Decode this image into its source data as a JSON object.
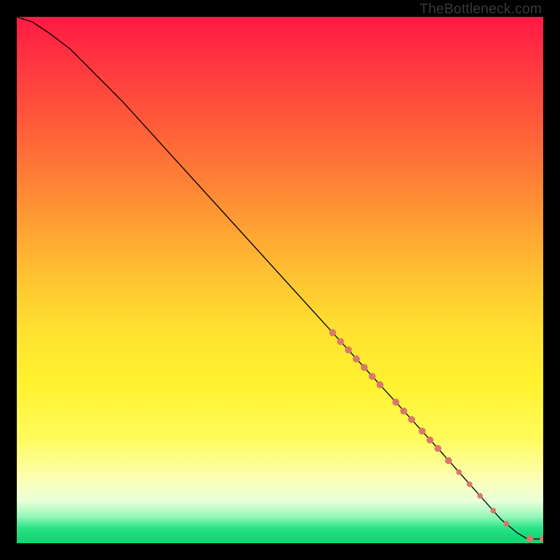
{
  "watermark": "TheBottleneck.com",
  "chart_data": {
    "type": "line",
    "title": "",
    "xlabel": "",
    "ylabel": "",
    "xlim": [
      0,
      100
    ],
    "ylim": [
      0,
      100
    ],
    "line": {
      "x": [
        0,
        3,
        6,
        10,
        15,
        20,
        30,
        40,
        50,
        60,
        70,
        80,
        88,
        92,
        95,
        97,
        100
      ],
      "y": [
        100,
        99,
        97,
        94,
        89,
        84,
        73,
        62,
        51,
        40,
        29,
        18,
        9,
        4.5,
        2,
        0.8,
        0.8
      ]
    },
    "markers": {
      "color": "#d9786b",
      "points": [
        {
          "x": 60.0,
          "y": 40.0,
          "r": 5
        },
        {
          "x": 61.5,
          "y": 38.3,
          "r": 5
        },
        {
          "x": 63.0,
          "y": 36.7,
          "r": 5
        },
        {
          "x": 64.5,
          "y": 35.0,
          "r": 5
        },
        {
          "x": 66.0,
          "y": 33.4,
          "r": 5
        },
        {
          "x": 67.5,
          "y": 31.7,
          "r": 5
        },
        {
          "x": 69.0,
          "y": 30.1,
          "r": 5
        },
        {
          "x": 72.0,
          "y": 26.8,
          "r": 5
        },
        {
          "x": 73.5,
          "y": 25.1,
          "r": 5
        },
        {
          "x": 75.0,
          "y": 23.5,
          "r": 5
        },
        {
          "x": 77.0,
          "y": 21.3,
          "r": 5
        },
        {
          "x": 78.5,
          "y": 19.6,
          "r": 5
        },
        {
          "x": 80.0,
          "y": 18.0,
          "r": 5
        },
        {
          "x": 82.0,
          "y": 15.7,
          "r": 5
        },
        {
          "x": 84.0,
          "y": 13.5,
          "r": 4
        },
        {
          "x": 86.0,
          "y": 11.2,
          "r": 4
        },
        {
          "x": 88.0,
          "y": 9.0,
          "r": 4
        },
        {
          "x": 90.5,
          "y": 6.2,
          "r": 4
        },
        {
          "x": 93.0,
          "y": 3.7,
          "r": 4
        },
        {
          "x": 97.5,
          "y": 0.8,
          "r": 5
        },
        {
          "x": 100.0,
          "y": 0.8,
          "r": 5
        }
      ]
    }
  }
}
